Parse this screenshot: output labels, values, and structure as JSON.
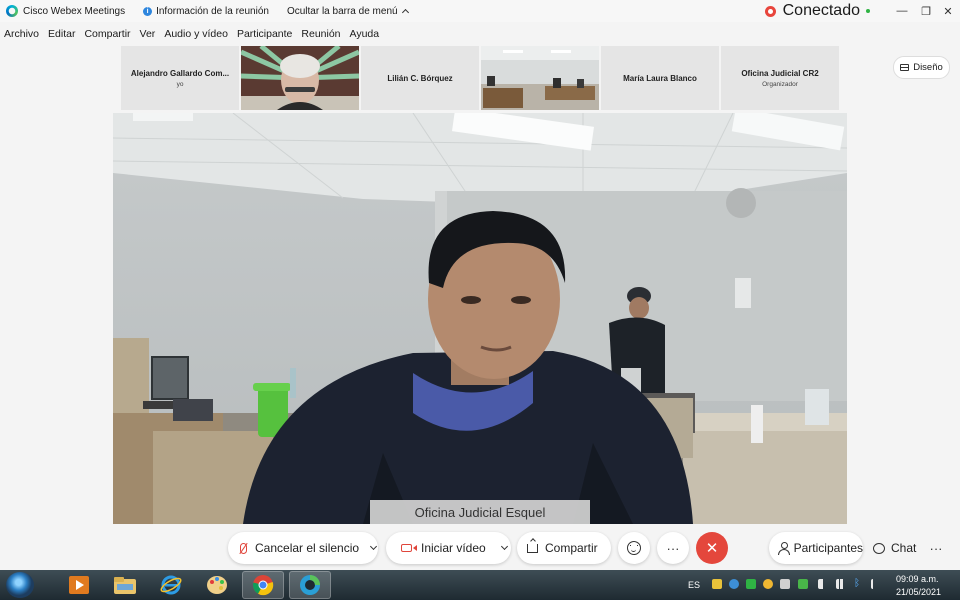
{
  "window": {
    "app_title": "Cisco Webex Meetings",
    "meeting_info": "Información de la reunión",
    "hide_menu": "Ocultar la barra de menú",
    "status": "Conectado",
    "controls": [
      "—",
      "❐",
      "✕"
    ]
  },
  "menu": [
    "Archivo",
    "Editar",
    "Compartir",
    "Ver",
    "Audio y vídeo",
    "Participante",
    "Reunión",
    "Ayuda"
  ],
  "participants": [
    {
      "name": "Alejandro Gallardo Com...",
      "sub": "yo"
    },
    {
      "name": "Lilián C. Bórquez",
      "sub": ""
    },
    {
      "name": "María Laura Blanco",
      "sub": ""
    },
    {
      "name": "Oficina Judicial CR2",
      "sub": "Organizador"
    }
  ],
  "layout_button": "Diseño",
  "main_video": {
    "speaker_label": "Oficina Judicial Esquel"
  },
  "controls": {
    "unmute": "Cancelar el silencio",
    "start_video": "Iniciar vídeo",
    "share": "Compartir",
    "participants": "Participantes",
    "chat": "Chat",
    "more": "···",
    "end": "✕"
  },
  "taskbar": {
    "language": "ES",
    "time": "09:09 a.m.",
    "date": "21/05/2021"
  }
}
